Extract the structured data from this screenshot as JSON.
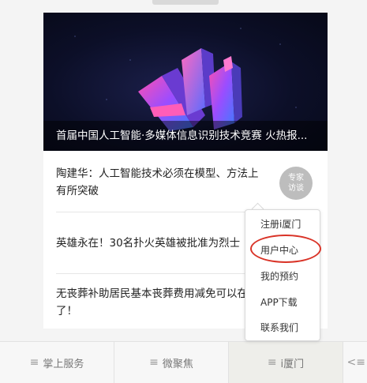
{
  "top_tag": "",
  "banner": {
    "caption": "首届中国人工智能·多媒体信息识别技术竞赛 火热报..."
  },
  "news": [
    "陶建华：人工智能技术必须在模型、方法上有所突破",
    "英雄永在！30名扑火英雄被批准为烈士",
    "无丧葬补助居民基本丧葬费用减免可以在\"i厦门\"上申请了！"
  ],
  "expert_badge": "专家\n访谈",
  "popup_menu": {
    "items": [
      "注册i厦门",
      "用户中心",
      "我的预约",
      "APP下载",
      "联系我们"
    ]
  },
  "tabbar": {
    "tabs": [
      {
        "label": "掌上服务"
      },
      {
        "label": "微聚焦"
      },
      {
        "label": "i厦门"
      }
    ]
  },
  "colors": {
    "highlight": "#d93327",
    "banner_bg": "#0c0f28"
  }
}
